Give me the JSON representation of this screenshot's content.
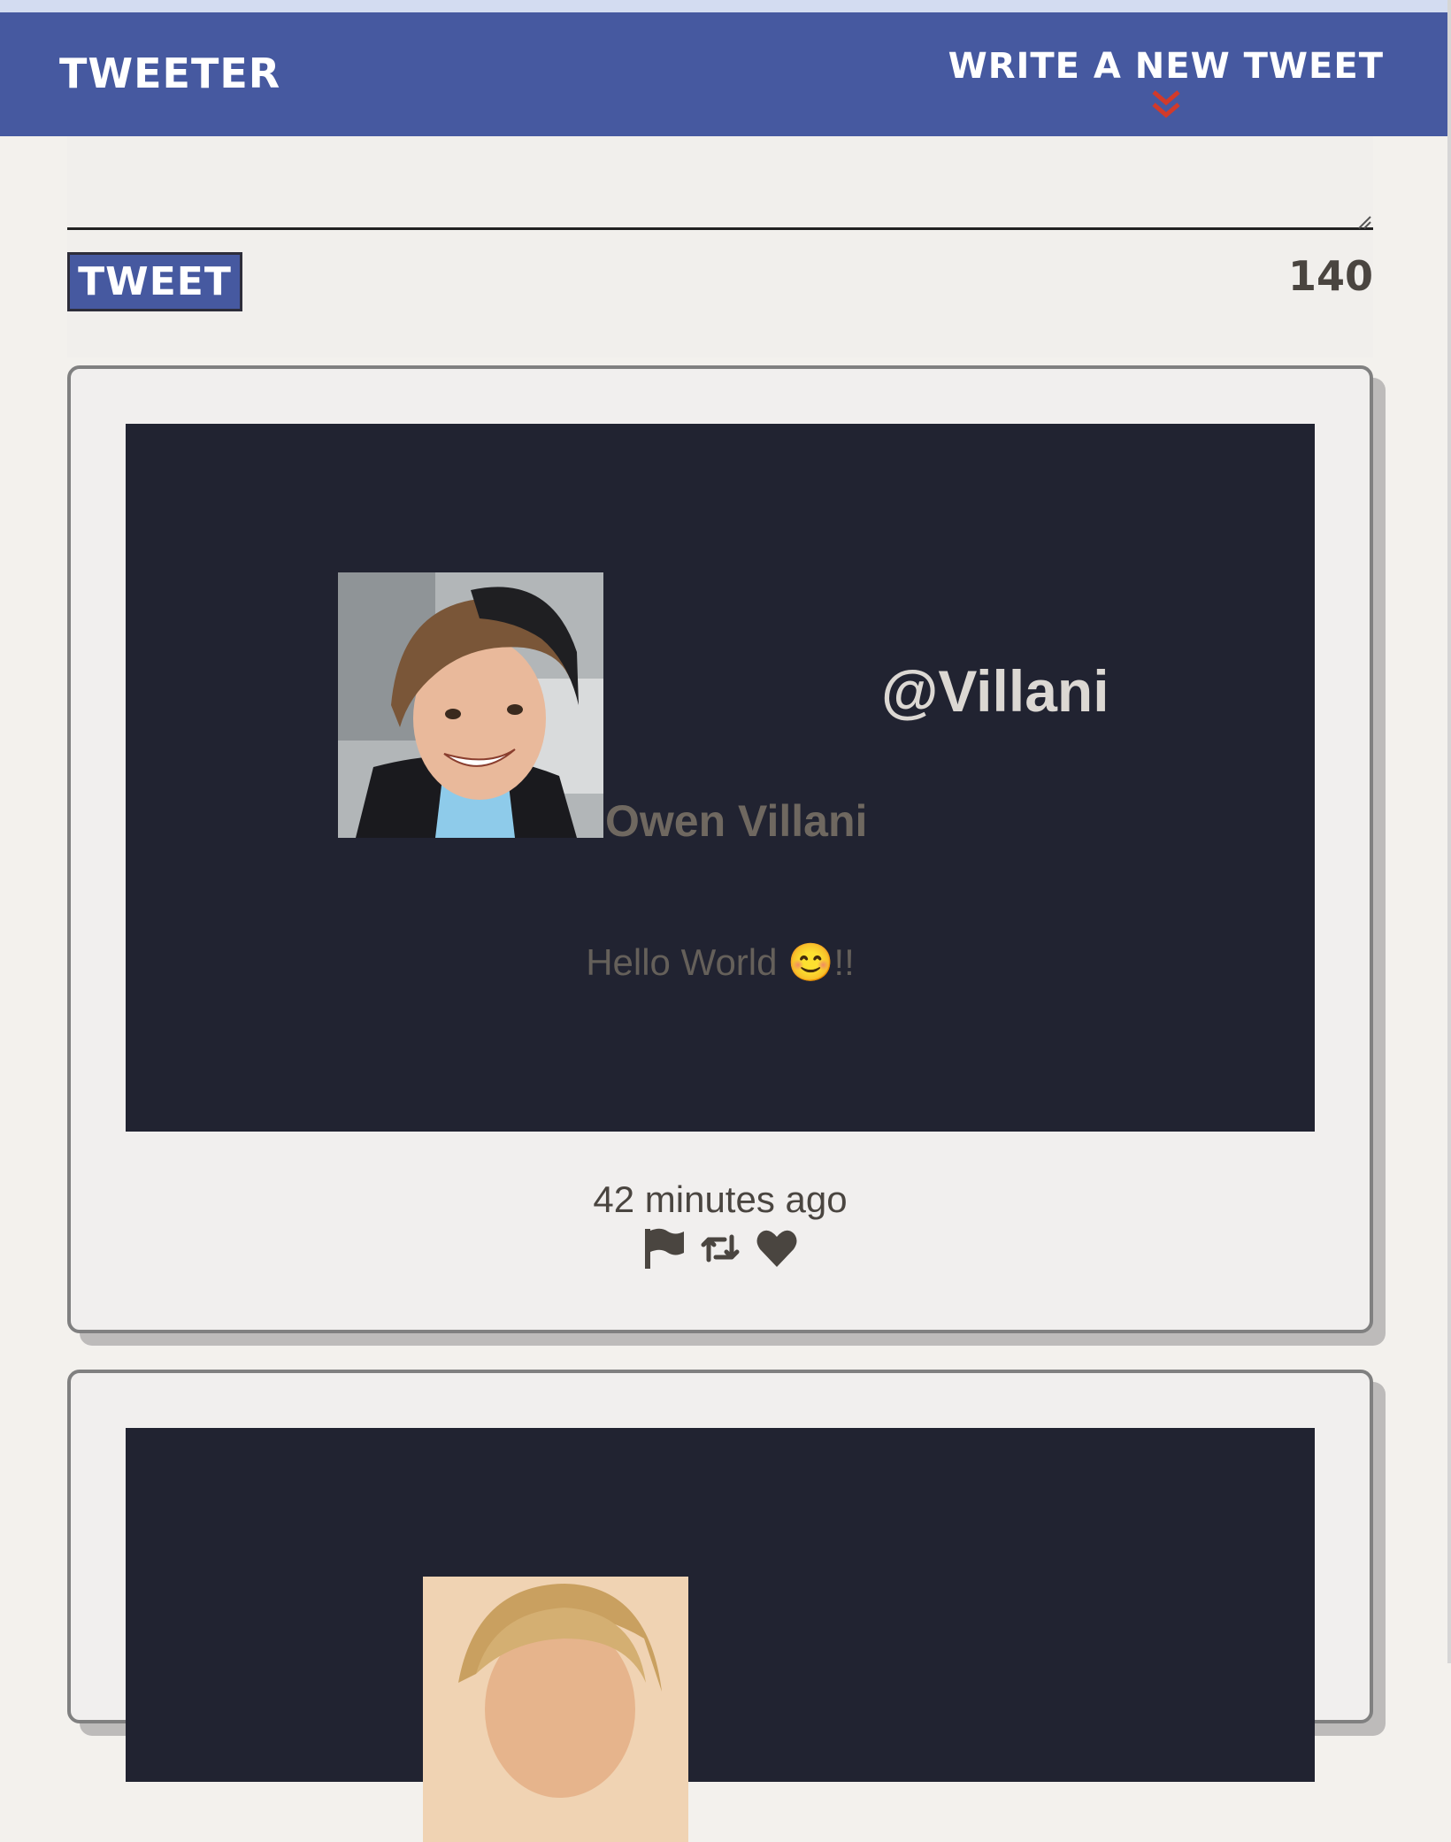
{
  "nav": {
    "brand": "TWEETER",
    "compose_label": "WRITE A NEW TWEET",
    "accent_color": "#4659a0",
    "chevron_color": "#d23a2a"
  },
  "compose": {
    "textarea_value": "",
    "button_label": "TWEET",
    "char_count": "140"
  },
  "tweets": [
    {
      "handle": "@Villani",
      "name": "Owen Villani",
      "content": "Hello World 😊!!",
      "timestamp": "42 minutes ago",
      "actions": [
        "flag-icon",
        "retweet-icon",
        "heart-icon"
      ]
    },
    {
      "handle": "",
      "name": "",
      "content": "",
      "timestamp": ""
    }
  ]
}
